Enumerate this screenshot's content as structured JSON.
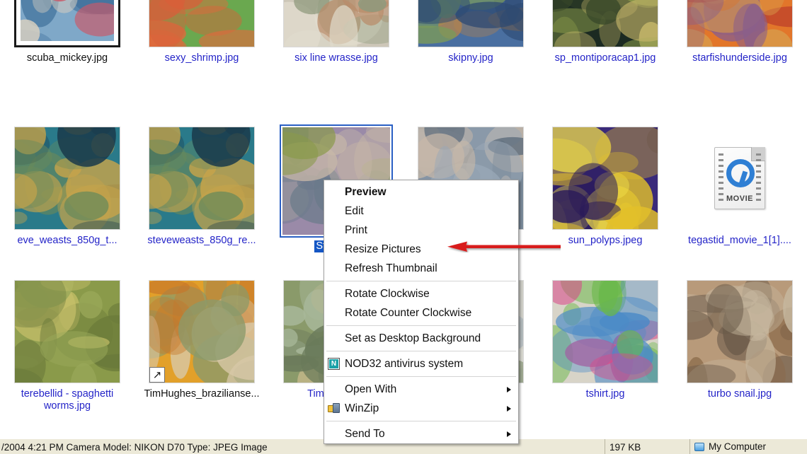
{
  "window": {
    "view_mode": "Thumbnails"
  },
  "grid": {
    "rows": [
      {
        "items": [
          {
            "label": "scuba_mickey.jpg",
            "style": "dark",
            "icon": "photo-thumbnail-framed",
            "colors": [
              "#7fa8c8",
              "#3f6f9a",
              "#c95a6a",
              "#d8cfc0"
            ]
          },
          {
            "label": "sexy_shrimp.jpg",
            "style": "link",
            "icon": "photo-thumbnail",
            "colors": [
              "#6aa84f",
              "#e2683c",
              "#c7dba0",
              "#d85f3a"
            ]
          },
          {
            "label": "six line wrasse.jpg",
            "style": "link",
            "icon": "photo-thumbnail",
            "colors": [
              "#cdc7b8",
              "#8e9a7d",
              "#b98c6a",
              "#e0dccd"
            ]
          },
          {
            "label": "skipny.jpg",
            "style": "link",
            "icon": "photo-thumbnail",
            "colors": [
              "#4a6fa0",
              "#7a9a5a",
              "#b8844a",
              "#2e4a72"
            ]
          },
          {
            "label": "sp_montiporacap1.jpg",
            "style": "link",
            "icon": "photo-thumbnail",
            "colors": [
              "#1b2a22",
              "#8a9a4a",
              "#c7b86a",
              "#3a4a2a"
            ]
          },
          {
            "label": "starfishunderside.jpg",
            "style": "link",
            "icon": "photo-thumbnail",
            "colors": [
              "#e2762a",
              "#c0452a",
              "#8a5f8a",
              "#d89a4a"
            ]
          }
        ]
      },
      {
        "items": [
          {
            "label": "eve_weasts_850g_t...",
            "style": "link",
            "icon": "photo-thumbnail",
            "colors": [
              "#2a7a8a",
              "#c7a44a",
              "#6a8a5a",
              "#1a3a4a"
            ]
          },
          {
            "label": "steveweasts_850g_re...",
            "style": "link",
            "icon": "photo-thumbnail",
            "colors": [
              "#2a7a8a",
              "#c7a44a",
              "#6a8a5a",
              "#1a3a4a"
            ]
          },
          {
            "label": "Stomatel",
            "style": "selected",
            "icon": "photo-thumbnail",
            "colors": [
              "#9a8aa8",
              "#8a9a4a",
              "#c7b8a8",
              "#6a7a8a"
            ]
          },
          {
            "label": "",
            "style": "link",
            "icon": "photo-thumbnail",
            "colors": [
              "#7a8a9a",
              "#c7b8a8",
              "#5a6a7a",
              "#9aa8b8"
            ]
          },
          {
            "label": "sun_polyps.jpeg",
            "style": "link",
            "icon": "photo-thumbnail",
            "colors": [
              "#3a2a7a",
              "#e2c02a",
              "#f2e04a",
              "#2a1a5a"
            ]
          },
          {
            "label": "tegastid_movie_1[1]....",
            "style": "link",
            "icon": "quicktime-movie-icon",
            "colors": []
          }
        ]
      },
      {
        "items": [
          {
            "label": "terebellid - spaghetti\nworms.jpg",
            "style": "link",
            "icon": "photo-thumbnail",
            "colors": [
              "#8a9a4a",
              "#c7c06a",
              "#6a7a3a",
              "#9aa85a"
            ]
          },
          {
            "label": "TimHughes_brazilianse...",
            "style": "dark",
            "icon": "photo-thumbnail-shortcut",
            "colors": [
              "#e2a02a",
              "#c7762a",
              "#8a9a6a",
              "#d8c8a8"
            ]
          },
          {
            "label": "TimHughes_",
            "style": "link",
            "icon": "photo-thumbnail",
            "colors": [
              "#8a9a6a",
              "#c7b88a",
              "#6a7a5a",
              "#a8b89a"
            ]
          },
          {
            "label": "",
            "style": "link",
            "icon": "photo-thumbnail",
            "colors": [
              "#c7c8c0",
              "#9aa8b8",
              "#8a9a7a",
              "#d8d8d0"
            ]
          },
          {
            "label": "tshirt.jpg",
            "style": "link",
            "icon": "photo-thumbnail",
            "colors": [
              "#d8d4c8",
              "#4a8ac7",
              "#d84a8a",
              "#6ab84a"
            ]
          },
          {
            "label": "turbo snail.jpg",
            "style": "link",
            "icon": "photo-thumbnail",
            "colors": [
              "#b89a7a",
              "#8a6a4a",
              "#c7b8a0",
              "#6a5a4a"
            ]
          }
        ]
      }
    ]
  },
  "context_menu": {
    "items": [
      {
        "label": "Preview",
        "bold": true,
        "icon": null,
        "submenu": false
      },
      {
        "label": "Edit",
        "bold": false,
        "icon": null,
        "submenu": false
      },
      {
        "label": "Print",
        "bold": false,
        "icon": null,
        "submenu": false
      },
      {
        "label": "Resize Pictures",
        "bold": false,
        "icon": null,
        "submenu": false
      },
      {
        "label": "Refresh Thumbnail",
        "bold": false,
        "icon": null,
        "submenu": false
      },
      {
        "separator": true
      },
      {
        "label": "Rotate Clockwise",
        "bold": false,
        "icon": null,
        "submenu": false
      },
      {
        "label": "Rotate Counter Clockwise",
        "bold": false,
        "icon": null,
        "submenu": false
      },
      {
        "separator": true
      },
      {
        "label": "Set as Desktop Background",
        "bold": false,
        "icon": null,
        "submenu": false
      },
      {
        "separator": true
      },
      {
        "label": "NOD32 antivirus system",
        "bold": false,
        "icon": "nod32-icon",
        "submenu": false
      },
      {
        "separator": true
      },
      {
        "label": "Open With",
        "bold": false,
        "icon": null,
        "submenu": true
      },
      {
        "label": "WinZip",
        "bold": false,
        "icon": "winzip-icon",
        "submenu": true
      },
      {
        "separator": true
      },
      {
        "label": "Send To",
        "bold": false,
        "icon": null,
        "submenu": true
      }
    ]
  },
  "annotation": {
    "arrow_color": "#d81f1f",
    "points_to": "Resize Pictures"
  },
  "status_bar": {
    "info": "/2004 4:21 PM Camera Model: NIKON D70 Type: JPEG Image",
    "size": "197 KB",
    "location": "My Computer"
  }
}
